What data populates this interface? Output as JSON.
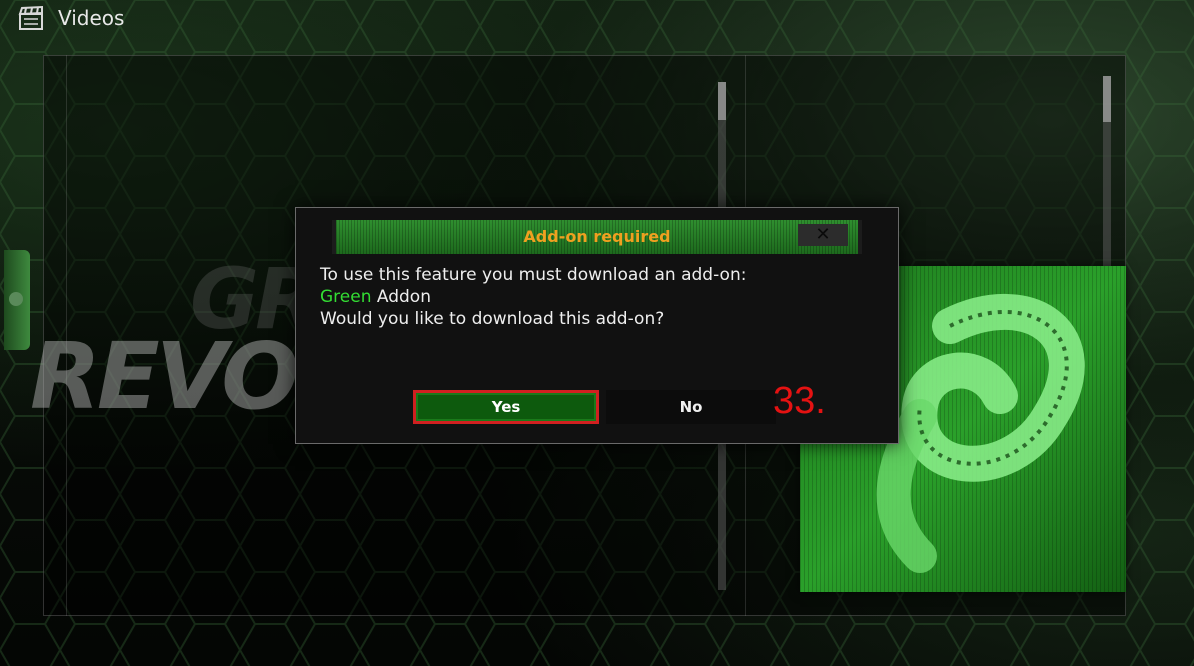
{
  "header": {
    "title": "Videos",
    "icon": "clapperboard-icon"
  },
  "background": {
    "brand_line1": "GR",
    "brand_line2": "REVO"
  },
  "dialog": {
    "title": "Add-on required",
    "close_label": "✕",
    "message_line1": "To use this feature you must download an add-on:",
    "addon_highlight": "Green",
    "addon_rest": " Addon",
    "message_line3": "Would you like to download this add-on?",
    "yes_label": "Yes",
    "no_label": "No"
  },
  "annotation": {
    "step_number": "33."
  },
  "colors": {
    "accent_green": "#33dd33",
    "title_orange": "#f0a020",
    "focus_red": "#d02020",
    "step_red": "#e51212"
  }
}
